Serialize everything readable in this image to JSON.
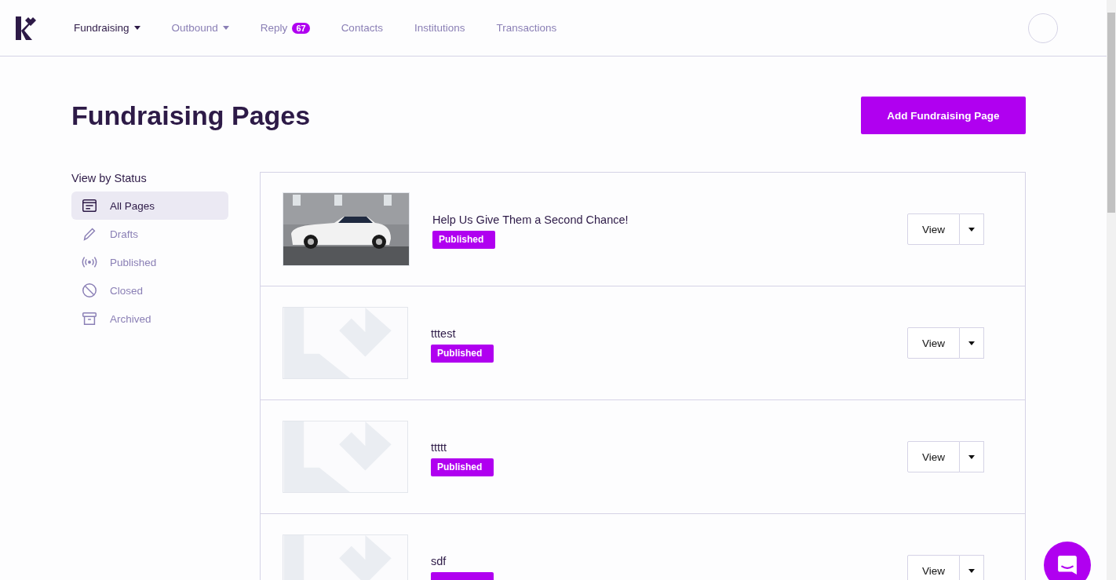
{
  "nav": {
    "items": [
      {
        "label": "Fundraising",
        "selected": true,
        "dropdown": true
      },
      {
        "label": "Outbound",
        "selected": false,
        "dropdown": true
      },
      {
        "label": "Reply",
        "selected": false,
        "badge": "67"
      },
      {
        "label": "Contacts",
        "selected": false
      },
      {
        "label": "Institutions",
        "selected": false
      },
      {
        "label": "Transactions",
        "selected": false
      }
    ]
  },
  "page_title": "Fundraising Pages",
  "add_button": "Add Fundraising Page",
  "sidebar": {
    "heading": "View by Status",
    "items": [
      {
        "label": "All Pages",
        "kind": "pages",
        "selected": true
      },
      {
        "label": "Drafts",
        "kind": "drafts",
        "selected": false
      },
      {
        "label": "Published",
        "kind": "published",
        "selected": false
      },
      {
        "label": "Closed",
        "kind": "closed",
        "selected": false
      },
      {
        "label": "Archived",
        "kind": "archived",
        "selected": false
      }
    ]
  },
  "pages": [
    {
      "title": "Help Us Give Them a Second Chance!",
      "badge": true,
      "status": "Published",
      "kind": "picture",
      "action": "View"
    },
    {
      "title": "tttest",
      "badge": true,
      "status": "Published",
      "kind": "placeholder",
      "action": "View"
    },
    {
      "title": "ttttt",
      "badge": true,
      "status": "Published",
      "kind": "placeholder",
      "action": "View"
    },
    {
      "title": "sdf",
      "badge": true,
      "kind": "placeholder",
      "action": "View"
    }
  ]
}
